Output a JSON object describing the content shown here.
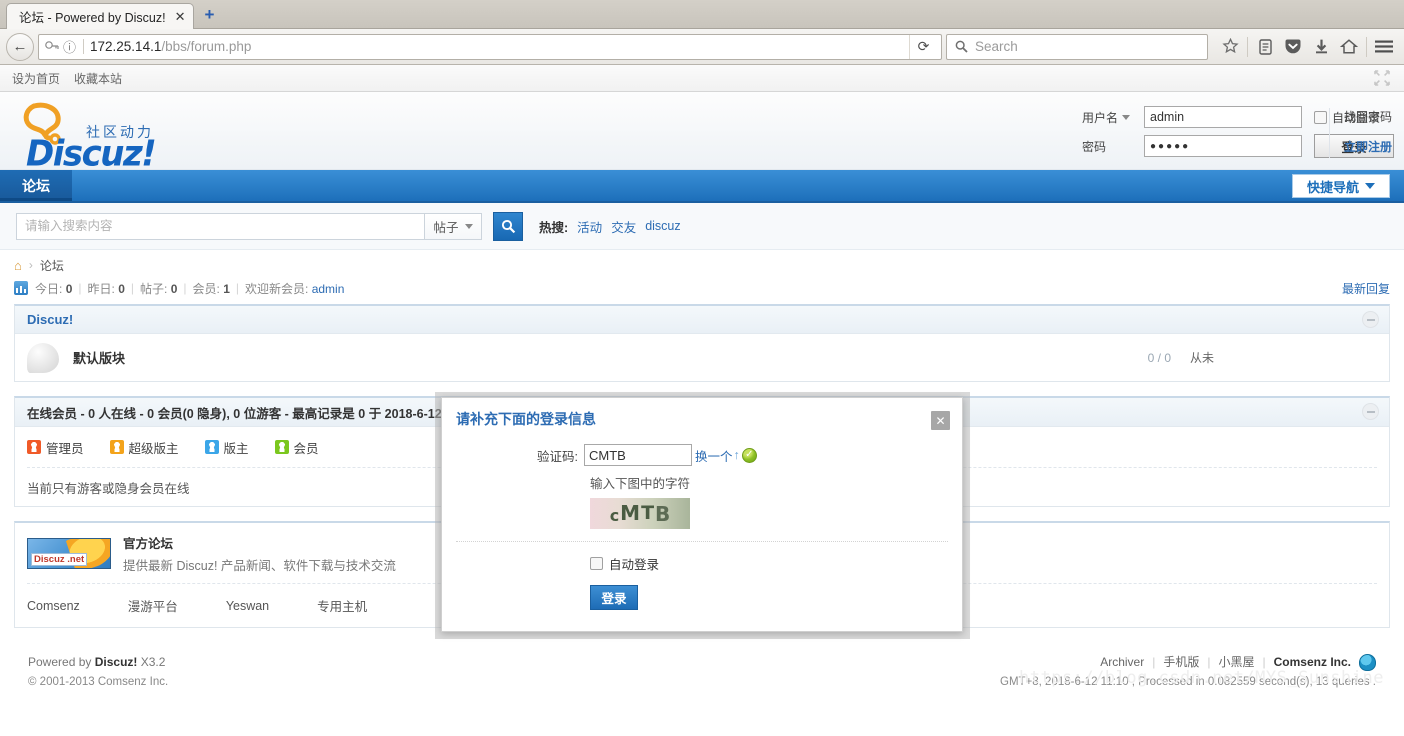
{
  "browser": {
    "tab": {
      "title": "论坛 - Powered by Discuz!",
      "close_label": "✕"
    },
    "newtab_label": "+",
    "back_label": "←",
    "url_prefix": "172.25.14.1",
    "url_suffix": "/bbs/forum.php",
    "reload_label": "⟳",
    "search_placeholder": "Search",
    "icons": {
      "key": "key-icon",
      "info": "ⓘ",
      "bookmark": "★",
      "reader": "▤",
      "pocket": "pocket-icon",
      "downloads": "⬇",
      "home": "⌂",
      "menu": "≡"
    }
  },
  "topbar": {
    "set_home": "设为首页",
    "bookmark_site": "收藏本站",
    "collapse_label": "collapse-icon"
  },
  "header": {
    "logo_sub": "社区动力",
    "logo_word": "Discuz!",
    "login": {
      "username_label": "用户名",
      "username_value": "admin",
      "password_label": "密码",
      "password_value": "●●●●●",
      "auto_login_label": "自动登录",
      "submit_label": "登录",
      "forgot_label": "找回密码",
      "register_label": "立即注册"
    }
  },
  "nav": {
    "tabs": [
      {
        "label": "论坛"
      }
    ],
    "quick_nav_label": "快捷导航"
  },
  "search": {
    "placeholder": "请输入搜索内容",
    "type_label": "帖子",
    "button_label": "search-icon",
    "hot_label": "热搜:",
    "hot_items": [
      "活动",
      "交友",
      "discuz"
    ]
  },
  "breadcrumb": {
    "home_icon": "home-icon",
    "separator": "›",
    "items": [
      "论坛"
    ]
  },
  "stats": {
    "items": [
      {
        "label": "今日:",
        "value": "0"
      },
      {
        "label": "昨日:",
        "value": "0"
      },
      {
        "label": "帖子:",
        "value": "0"
      },
      {
        "label": "会员:",
        "value": "1"
      }
    ],
    "welcome_label": "欢迎新会员:",
    "welcome_user": "admin",
    "latest_reply": "最新回复"
  },
  "category": {
    "title": "Discuz!",
    "forums": [
      {
        "name": "默认版块",
        "counts": "0 / 0",
        "last": "从未"
      }
    ]
  },
  "online": {
    "header": "在线会员 - 0 人在线 - 0 会员(0 隐身), 0 位游客 - 最高记录是 0 于 2018-6-12",
    "groups": [
      {
        "label": "管理员",
        "color": "#f05a28"
      },
      {
        "label": "超级版主",
        "color": "#f3a31b"
      },
      {
        "label": "版主",
        "color": "#3ba6e8"
      },
      {
        "label": "会员",
        "color": "#7bc71e"
      }
    ],
    "note": "当前只有游客或隐身会员在线"
  },
  "partner": {
    "badge_label": "Discuz .net",
    "title": "官方论坛",
    "desc": "提供最新 Discuz! 产品新闻、软件下载与技术交流",
    "links": [
      "Comsenz",
      "漫游平台",
      "Yeswan",
      "专用主机"
    ]
  },
  "footer": {
    "powered_prefix": "Powered by",
    "powered_brand": "Discuz!",
    "powered_version": "X3.2",
    "copyright": "© 2001-2013 Comsenz Inc.",
    "links": [
      "Archiver",
      "手机版",
      "小黑屋"
    ],
    "comsenz": "Comsenz Inc.",
    "meta": "GMT+8, 2018-6-12 11:10 , Processed in 0.082559 second(s), 13 queries .",
    "watermark": "https://blog.csdn.net/MYS_Sunshine"
  },
  "modal": {
    "title": "请补充下面的登录信息",
    "close_label": "✕",
    "captcha_label": "验证码:",
    "captcha_value": "CMTB",
    "refresh_label": "换一个",
    "refresh_arrow": "↑",
    "ok_mark": "✓",
    "hint": "输入下图中的字符",
    "captcha_image_text": "cMTB",
    "auto_login_label": "自动登录",
    "submit_label": "登录"
  }
}
